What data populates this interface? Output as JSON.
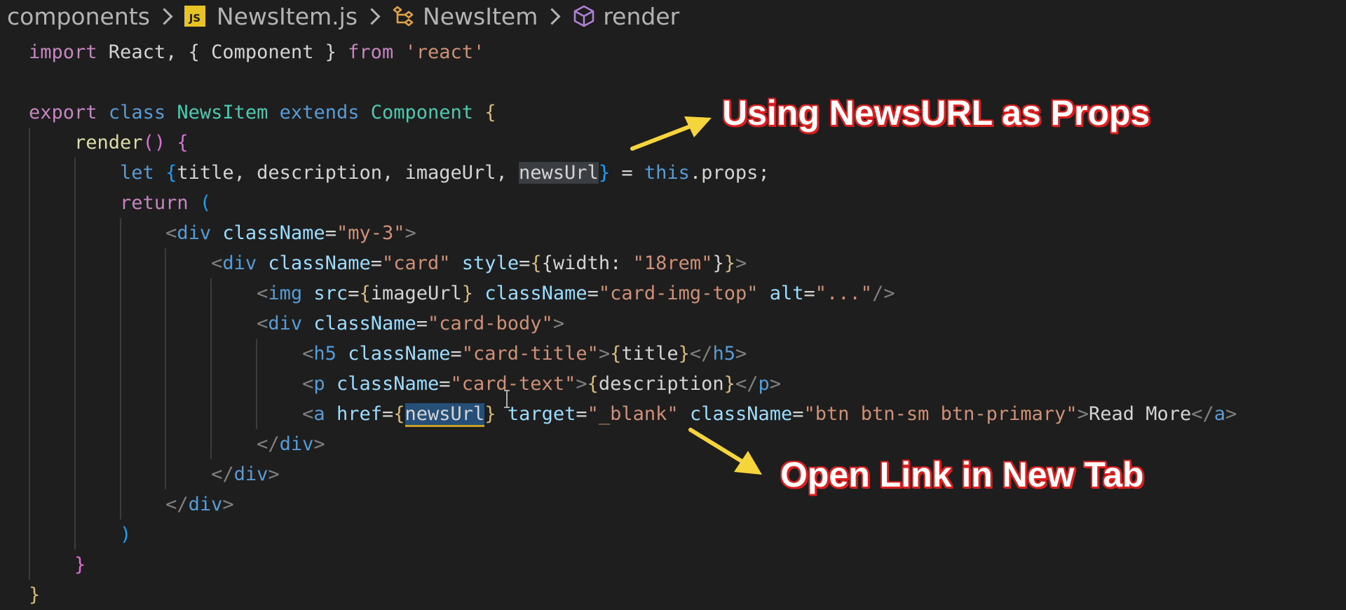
{
  "breadcrumb": {
    "folder": "components",
    "js_badge": "JS",
    "file": "NewsItem.js",
    "class_name": "NewsItem",
    "method": "render"
  },
  "code_lines": [
    {
      "segments": [
        {
          "t": "import",
          "c": "kw-purple"
        },
        {
          "t": " React, { Component } ",
          "c": "plain"
        },
        {
          "t": "from",
          "c": "kw-purple"
        },
        {
          "t": " ",
          "c": "plain"
        },
        {
          "t": "'react'",
          "c": "str"
        }
      ]
    },
    {
      "segments": []
    },
    {
      "segments": [
        {
          "t": "export",
          "c": "kw-purple"
        },
        {
          "t": " ",
          "c": "plain"
        },
        {
          "t": "class",
          "c": "kw-blue"
        },
        {
          "t": " ",
          "c": "plain"
        },
        {
          "t": "NewsItem",
          "c": "cls"
        },
        {
          "t": " ",
          "c": "plain"
        },
        {
          "t": "extends",
          "c": "kw-blue"
        },
        {
          "t": " ",
          "c": "plain"
        },
        {
          "t": "Component",
          "c": "cls"
        },
        {
          "t": " ",
          "c": "plain"
        },
        {
          "t": "{",
          "c": "brace-y"
        }
      ]
    },
    {
      "segments": [
        {
          "t": "    ",
          "c": "plain"
        },
        {
          "t": "render",
          "c": "fn"
        },
        {
          "t": "()",
          "c": "brace-p"
        },
        {
          "t": " ",
          "c": "plain"
        },
        {
          "t": "{",
          "c": "brace-p"
        }
      ]
    },
    {
      "segments": [
        {
          "t": "        ",
          "c": "plain"
        },
        {
          "t": "let",
          "c": "kw-blue"
        },
        {
          "t": " ",
          "c": "plain"
        },
        {
          "t": "{",
          "c": "brace-b"
        },
        {
          "t": "title, description, imageUrl, ",
          "c": "plain"
        },
        {
          "t": "newsUrl",
          "c": "plain hl"
        },
        {
          "t": "}",
          "c": "brace-b"
        },
        {
          "t": " = ",
          "c": "plain"
        },
        {
          "t": "this",
          "c": "kw-blue"
        },
        {
          "t": ".props;",
          "c": "plain"
        }
      ]
    },
    {
      "segments": [
        {
          "t": "        ",
          "c": "plain"
        },
        {
          "t": "return",
          "c": "kw-purple"
        },
        {
          "t": " ",
          "c": "plain"
        },
        {
          "t": "(",
          "c": "brace-b"
        }
      ]
    },
    {
      "segments": [
        {
          "t": "            ",
          "c": "plain"
        },
        {
          "t": "<",
          "c": "punct"
        },
        {
          "t": "div",
          "c": "tag"
        },
        {
          "t": " ",
          "c": "plain"
        },
        {
          "t": "className",
          "c": "attr"
        },
        {
          "t": "=",
          "c": "plain"
        },
        {
          "t": "\"my-3\"",
          "c": "str"
        },
        {
          "t": ">",
          "c": "punct"
        }
      ]
    },
    {
      "segments": [
        {
          "t": "                ",
          "c": "plain"
        },
        {
          "t": "<",
          "c": "punct"
        },
        {
          "t": "div",
          "c": "tag"
        },
        {
          "t": " ",
          "c": "plain"
        },
        {
          "t": "className",
          "c": "attr"
        },
        {
          "t": "=",
          "c": "plain"
        },
        {
          "t": "\"card\"",
          "c": "str"
        },
        {
          "t": " ",
          "c": "plain"
        },
        {
          "t": "style",
          "c": "attr"
        },
        {
          "t": "=",
          "c": "plain"
        },
        {
          "t": "{",
          "c": "brace-y"
        },
        {
          "t": "{width: ",
          "c": "plain"
        },
        {
          "t": "\"18rem\"",
          "c": "str"
        },
        {
          "t": "}",
          "c": "plain"
        },
        {
          "t": "}",
          "c": "brace-y"
        },
        {
          "t": ">",
          "c": "punct"
        }
      ]
    },
    {
      "segments": [
        {
          "t": "                    ",
          "c": "plain"
        },
        {
          "t": "<",
          "c": "punct"
        },
        {
          "t": "img",
          "c": "tag"
        },
        {
          "t": " ",
          "c": "plain"
        },
        {
          "t": "src",
          "c": "attr"
        },
        {
          "t": "=",
          "c": "plain"
        },
        {
          "t": "{",
          "c": "brace-y"
        },
        {
          "t": "imageUrl",
          "c": "plain"
        },
        {
          "t": "}",
          "c": "brace-y"
        },
        {
          "t": " ",
          "c": "plain"
        },
        {
          "t": "className",
          "c": "attr"
        },
        {
          "t": "=",
          "c": "plain"
        },
        {
          "t": "\"card-img-top\"",
          "c": "str"
        },
        {
          "t": " ",
          "c": "plain"
        },
        {
          "t": "alt",
          "c": "attr"
        },
        {
          "t": "=",
          "c": "plain"
        },
        {
          "t": "\"...\"",
          "c": "str"
        },
        {
          "t": "/>",
          "c": "punct"
        }
      ]
    },
    {
      "segments": [
        {
          "t": "                    ",
          "c": "plain"
        },
        {
          "t": "<",
          "c": "punct"
        },
        {
          "t": "div",
          "c": "tag"
        },
        {
          "t": " ",
          "c": "plain"
        },
        {
          "t": "className",
          "c": "attr"
        },
        {
          "t": "=",
          "c": "plain"
        },
        {
          "t": "\"card-body\"",
          "c": "str"
        },
        {
          "t": ">",
          "c": "punct"
        }
      ]
    },
    {
      "segments": [
        {
          "t": "                        ",
          "c": "plain"
        },
        {
          "t": "<",
          "c": "punct"
        },
        {
          "t": "h5",
          "c": "tag"
        },
        {
          "t": " ",
          "c": "plain"
        },
        {
          "t": "className",
          "c": "attr"
        },
        {
          "t": "=",
          "c": "plain"
        },
        {
          "t": "\"card-title\"",
          "c": "str"
        },
        {
          "t": ">",
          "c": "punct"
        },
        {
          "t": "{",
          "c": "brace-y"
        },
        {
          "t": "title",
          "c": "plain"
        },
        {
          "t": "}",
          "c": "brace-y"
        },
        {
          "t": "</",
          "c": "punct"
        },
        {
          "t": "h5",
          "c": "tag"
        },
        {
          "t": ">",
          "c": "punct"
        }
      ]
    },
    {
      "segments": [
        {
          "t": "                        ",
          "c": "plain"
        },
        {
          "t": "<",
          "c": "punct"
        },
        {
          "t": "p",
          "c": "tag"
        },
        {
          "t": " ",
          "c": "plain"
        },
        {
          "t": "className",
          "c": "attr"
        },
        {
          "t": "=",
          "c": "plain"
        },
        {
          "t": "\"card-text\"",
          "c": "str"
        },
        {
          "t": ">",
          "c": "punct"
        },
        {
          "t": "{",
          "c": "brace-y"
        },
        {
          "t": "description",
          "c": "plain"
        },
        {
          "t": "}",
          "c": "brace-y"
        },
        {
          "t": "</",
          "c": "punct"
        },
        {
          "t": "p",
          "c": "tag"
        },
        {
          "t": ">",
          "c": "punct"
        }
      ]
    },
    {
      "segments": [
        {
          "t": "                        ",
          "c": "plain"
        },
        {
          "t": "<",
          "c": "punct"
        },
        {
          "t": "a",
          "c": "tag"
        },
        {
          "t": " ",
          "c": "plain"
        },
        {
          "t": "href",
          "c": "attr"
        },
        {
          "t": "=",
          "c": "plain"
        },
        {
          "t": "{",
          "c": "brace-y"
        },
        {
          "t": "newsUrl",
          "c": "plain hl-sel"
        },
        {
          "t": "}",
          "c": "brace-y"
        },
        {
          "t": " ",
          "c": "plain"
        },
        {
          "t": "target",
          "c": "attr"
        },
        {
          "t": "=",
          "c": "plain"
        },
        {
          "t": "\"_blank\"",
          "c": "str"
        },
        {
          "t": " ",
          "c": "plain"
        },
        {
          "t": "className",
          "c": "attr"
        },
        {
          "t": "=",
          "c": "plain"
        },
        {
          "t": "\"btn btn-sm btn-primary\"",
          "c": "str"
        },
        {
          "t": ">",
          "c": "punct"
        },
        {
          "t": "Read More",
          "c": "plain"
        },
        {
          "t": "</",
          "c": "punct"
        },
        {
          "t": "a",
          "c": "tag"
        },
        {
          "t": ">",
          "c": "punct"
        }
      ]
    },
    {
      "segments": [
        {
          "t": "                    ",
          "c": "plain"
        },
        {
          "t": "</",
          "c": "punct"
        },
        {
          "t": "div",
          "c": "tag"
        },
        {
          "t": ">",
          "c": "punct"
        }
      ]
    },
    {
      "segments": [
        {
          "t": "                ",
          "c": "plain"
        },
        {
          "t": "</",
          "c": "punct"
        },
        {
          "t": "div",
          "c": "tag"
        },
        {
          "t": ">",
          "c": "punct"
        }
      ]
    },
    {
      "segments": [
        {
          "t": "            ",
          "c": "plain"
        },
        {
          "t": "</",
          "c": "punct"
        },
        {
          "t": "div",
          "c": "tag"
        },
        {
          "t": ">",
          "c": "punct"
        }
      ]
    },
    {
      "segments": [
        {
          "t": "        ",
          "c": "plain"
        },
        {
          "t": ")",
          "c": "brace-b"
        }
      ]
    },
    {
      "segments": [
        {
          "t": "    ",
          "c": "plain"
        },
        {
          "t": "}",
          "c": "brace-p"
        }
      ]
    },
    {
      "segments": [
        {
          "t": "}",
          "c": "brace-y"
        }
      ]
    }
  ],
  "annotations": {
    "top": "Using NewsURL as Props",
    "bottom": "Open Link in New Tab"
  },
  "colors": {
    "background": "#1e1e1e",
    "annotation_text": "#ffffff",
    "annotation_outline": "#d91f1f",
    "arrow": "#f5d53b"
  }
}
